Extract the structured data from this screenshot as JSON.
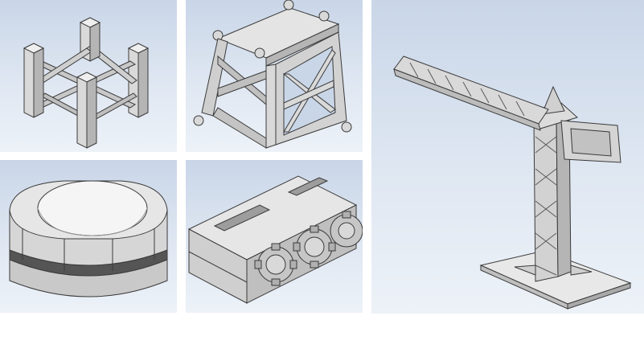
{
  "layout_hint": "image-grid",
  "colors": {
    "viewport_top": "#c9d6e8",
    "viewport_bottom": "#edf2f8",
    "model_fill": "#d9d9d9",
    "model_shade": "#b5b5b5",
    "model_edge": "#3a3a3a",
    "page_background": "#ffffff"
  },
  "panels": [
    {
      "model": "lattice-tower-section"
    },
    {
      "model": "truss-frame-bracket"
    },
    {
      "model": "rounded-square-ring-housing"
    },
    {
      "model": "gear-train-block"
    },
    {
      "model": "tower-crane-assembly"
    }
  ]
}
